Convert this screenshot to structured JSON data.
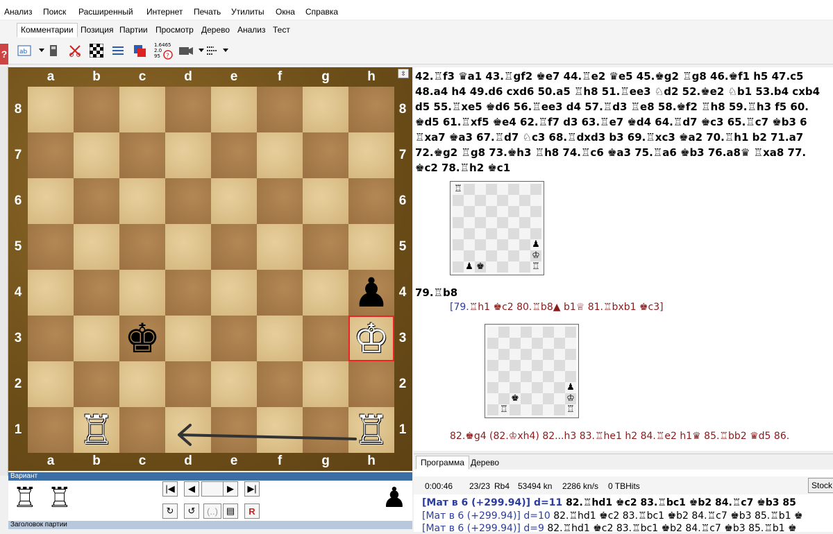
{
  "menu": [
    "Анализ",
    "Поиск",
    "Расширенный",
    "Интернет",
    "Печать",
    "Утилиты",
    "Окна",
    "Справка"
  ],
  "ribbon_tabs": [
    "Комментарии",
    "Позиция",
    "Партии",
    "Просмотр",
    "Дерево",
    "Анализ",
    "Тест"
  ],
  "ribbon_active": "Комментарии",
  "toolbar_icons": [
    "text-format-icon",
    "calculator-icon",
    "scissors-icon",
    "board-icon",
    "list-icon",
    "color-icon",
    "eval-icon",
    "camera-icon",
    "annotation-icon"
  ],
  "eval_icon_text": "1.6465\n2.0\n95",
  "help_icon": "?",
  "board": {
    "files": [
      "a",
      "b",
      "c",
      "d",
      "e",
      "f",
      "g",
      "h"
    ],
    "ranks": [
      "8",
      "7",
      "6",
      "5",
      "4",
      "3",
      "2",
      "1"
    ],
    "pieces": [
      {
        "square": "h4",
        "glyph": "♟",
        "color": "black"
      },
      {
        "square": "c3",
        "glyph": "♚",
        "color": "black"
      },
      {
        "square": "h3",
        "glyph": "♔",
        "color": "white"
      },
      {
        "square": "b1",
        "glyph": "♖",
        "color": "white"
      },
      {
        "square": "h1",
        "glyph": "♖",
        "color": "white"
      }
    ],
    "highlight_square": "h3",
    "arrow": {
      "from": "h1",
      "to": "d1"
    }
  },
  "variant_panel": {
    "title": "Вариант",
    "captured_white": [
      "♖",
      "♖"
    ],
    "captured_black": [
      "♟"
    ],
    "nav": [
      "|◀",
      "◀",
      "",
      "▶",
      "▶|"
    ]
  },
  "game_header": "Заголовок партии",
  "notation": {
    "lines": [
      "42.♖f3 ♛a1 43.♖gf2 ♚e7 44.♖e2 ♛e5 45.♚g2 ♖g8 46.♚f1 h5 47.c5",
      "48.a4 h4 49.d6 cxd6 50.a5 ♖h8 51.♖ee3 ♘d2 52.♚e2 ♘b1 53.b4 cxb4",
      "d5 55.♖xe5 ♚d6 56.♖ee3 d4 57.♖d3 ♖e8 58.♚f2 ♖h8 59.♖h3 f5 60.",
      "♚d5 61.♖xf5 ♚e4 62.♖f7 d3 63.♖e7 ♚d4 64.♖d7 ♚c3 65.♖c7 ♚b3 6",
      "♖xa7 ♚a3 67.♖d7 ♘c3 68.♖dxd3 b3 69.♖xc3 ♚a2 70.♖h1 b2 71.a7 ",
      "72.♚g2 ♖g8 73.♚h3 ♖h8 74.♖c6 ♚a3 75.♖a6 ♚b3 76.a8♛ ♖xa8 77.",
      "♚c2 78.♖h2 ♚c1"
    ],
    "move79": "79.♖b8",
    "variation_open": "[79.",
    "variation_rest": "♖h1 ♚c2 80.♖b8▲ b1♕ 81.♖bxb1 ♚c3]",
    "line82": "82.♚g4 (82.♔xh4) 82...h3 83.♖he1 h2 84.♖e2 h1♛ 85.♖bb2 ♛d5 86.",
    "diagram1": [
      {
        "square": "a8",
        "glyph": "♖"
      },
      {
        "square": "h3",
        "glyph": "♟"
      },
      {
        "square": "h2",
        "glyph": "♔"
      },
      {
        "square": "h1",
        "glyph": "♖"
      },
      {
        "square": "b1",
        "glyph": "♟"
      },
      {
        "square": "c1",
        "glyph": "♚"
      }
    ],
    "diagram2": [
      {
        "square": "h3",
        "glyph": "♟"
      },
      {
        "square": "c2",
        "glyph": "♚"
      },
      {
        "square": "h2",
        "glyph": "♔"
      },
      {
        "square": "b1",
        "glyph": "♖"
      },
      {
        "square": "h1",
        "glyph": "♖"
      }
    ]
  },
  "engine": {
    "tabs": [
      "Программа",
      "Дерево"
    ],
    "active_tab": "Программа",
    "time": "0:00:46",
    "depth": "23/23",
    "move": "Rb4",
    "nodes": "53494 kn",
    "speed": "2286 kn/s",
    "tbhits": "0 TBHits",
    "button": "Stock",
    "lines": [
      {
        "eval": "[Мат в 6 (+299.94)]",
        "depth": "d=11",
        "moves": "82.♖hd1 ♚c2 83.♖bc1 ♚b2 84.♖c7 ♚b3 85",
        "bold": true
      },
      {
        "eval": "[Мат в 6 (+299.94)]",
        "depth": "d=10",
        "moves": "82.♖hd1 ♚c2 83.♖bc1 ♚b2 84.♖c7 ♚b3 85.♖b1 ♚",
        "bold": false
      },
      {
        "eval": "[Мат в 6 (+299.94)]",
        "depth": "d=9",
        "moves": "82.♖hd1 ♚c2 83.♖bc1 ♚b2 84.♖c7 ♚b3 85.♖b1 ♚",
        "bold": false
      }
    ]
  }
}
